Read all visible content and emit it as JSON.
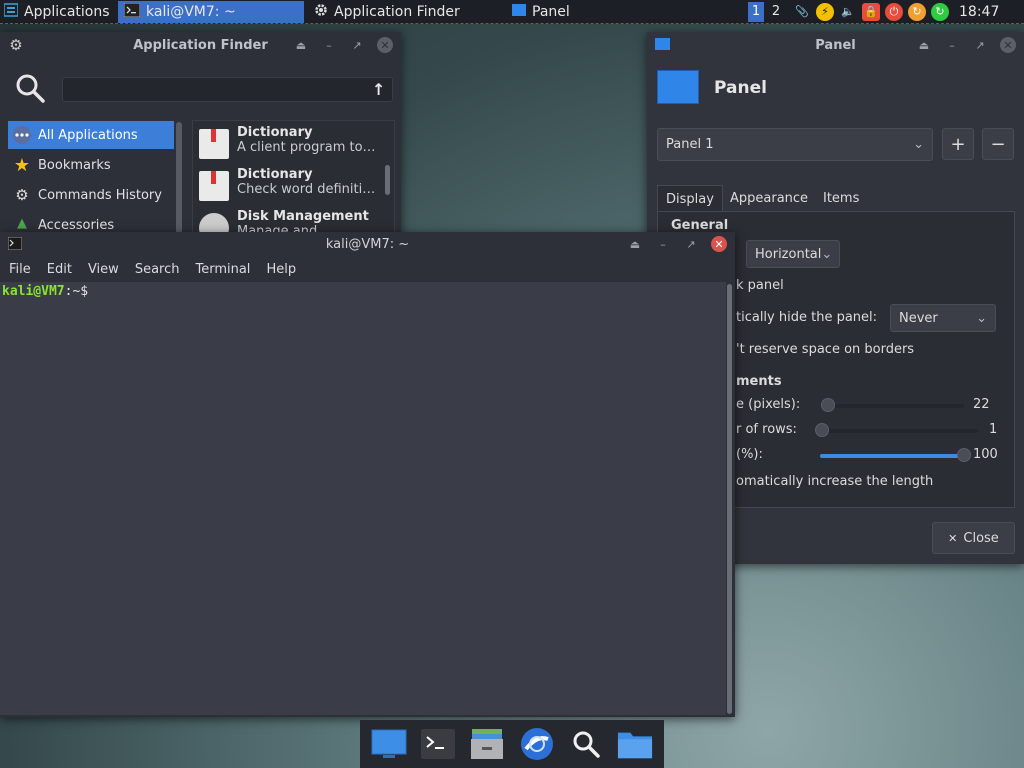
{
  "top_panel": {
    "applications_label": "Applications",
    "tasks": [
      {
        "label": "kali@VM7: ~",
        "icon": "terminal-icon",
        "active": true
      },
      {
        "label": "Application Finder",
        "icon": "gear-icon",
        "active": false
      },
      {
        "label": "Panel",
        "icon": "panel-icon",
        "active": false
      }
    ],
    "workspaces": [
      "1",
      "2"
    ],
    "clock": "18:47"
  },
  "app_finder": {
    "title": "Application Finder",
    "search_value": "",
    "categories": [
      {
        "label": "All Applications",
        "icon": "all-apps-icon",
        "selected": true
      },
      {
        "label": "Bookmarks",
        "icon": "star-icon",
        "selected": false
      },
      {
        "label": "Commands History",
        "icon": "gear-icon",
        "selected": false
      },
      {
        "label": "Accessories",
        "icon": "accessories-icon",
        "selected": false
      }
    ],
    "apps": [
      {
        "name": "Dictionary",
        "desc": "A client program to…"
      },
      {
        "name": "Dictionary",
        "desc": "Check word definiti…"
      },
      {
        "name": "Disk Management",
        "desc": "Manage and…"
      }
    ]
  },
  "panel_prefs": {
    "title": "Panel",
    "header_label": "Panel",
    "panel_select": "Panel 1",
    "add_label": "+",
    "remove_label": "−",
    "tabs": [
      "Display",
      "Appearance",
      "Items"
    ],
    "general_heading": "General",
    "mode_value": "Horizontal",
    "lock_label": "k panel",
    "autohide_label": "tically hide the panel:",
    "autohide_value": "Never",
    "reserve_label": "'t reserve space on borders",
    "measurements_heading": "ments",
    "size_label": "e (pixels):",
    "size_value": "22",
    "rows_label": "r of rows:",
    "rows_value": "1",
    "length_label": "(%):",
    "length_value": "100",
    "auto_length_label": "omatically increase the length",
    "close_label": "Close"
  },
  "terminal": {
    "title": "kali@VM7: ~",
    "menu": [
      "File",
      "Edit",
      "View",
      "Search",
      "Terminal",
      "Help"
    ],
    "prompt_user": "kali@VM7",
    "prompt_rest": ":~$"
  },
  "dock": {
    "items": [
      "show-desktop-icon",
      "terminal-icon",
      "file-manager-icon",
      "browser-icon",
      "search-icon",
      "folder-icon"
    ]
  },
  "colors": {
    "accent": "#3c6fc8",
    "prompt_green": "#8ae234",
    "close_red": "#d9534f"
  }
}
